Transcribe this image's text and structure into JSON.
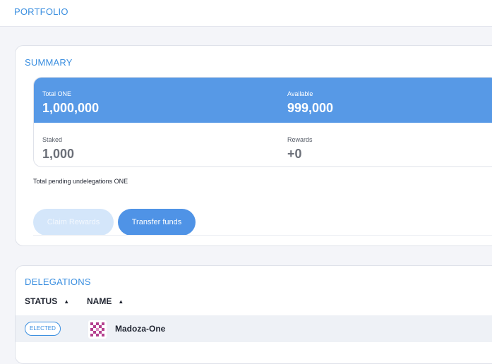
{
  "header": {
    "title": "PORTFOLIO"
  },
  "summary": {
    "title": "SUMMARY",
    "total_one": {
      "label": "Total ONE",
      "value": "1,000,000"
    },
    "available": {
      "label": "Available",
      "value": "999,000"
    },
    "staked": {
      "label": "Staked",
      "value": "1,000"
    },
    "rewards": {
      "label": "Rewards",
      "value": "+0"
    },
    "pending_text": "Total pending undelegations ONE",
    "claim_label": "Claim Rewards",
    "transfer_label": "Transfer funds"
  },
  "delegations": {
    "title": "DELEGATIONS",
    "columns": [
      {
        "label": "STATUS",
        "sort": "ascending"
      },
      {
        "label": "NAME",
        "sort": "ascending"
      }
    ],
    "rows": [
      {
        "status": "ELECTED",
        "name": "Madoza-One",
        "avatar": "identicon"
      }
    ]
  },
  "colors": {
    "accent": "#3b8fe0",
    "band": "#5799e6",
    "button_primary": "#4f93e6",
    "button_disabled": "#d4e6fa",
    "identicon": "#b5408f"
  }
}
